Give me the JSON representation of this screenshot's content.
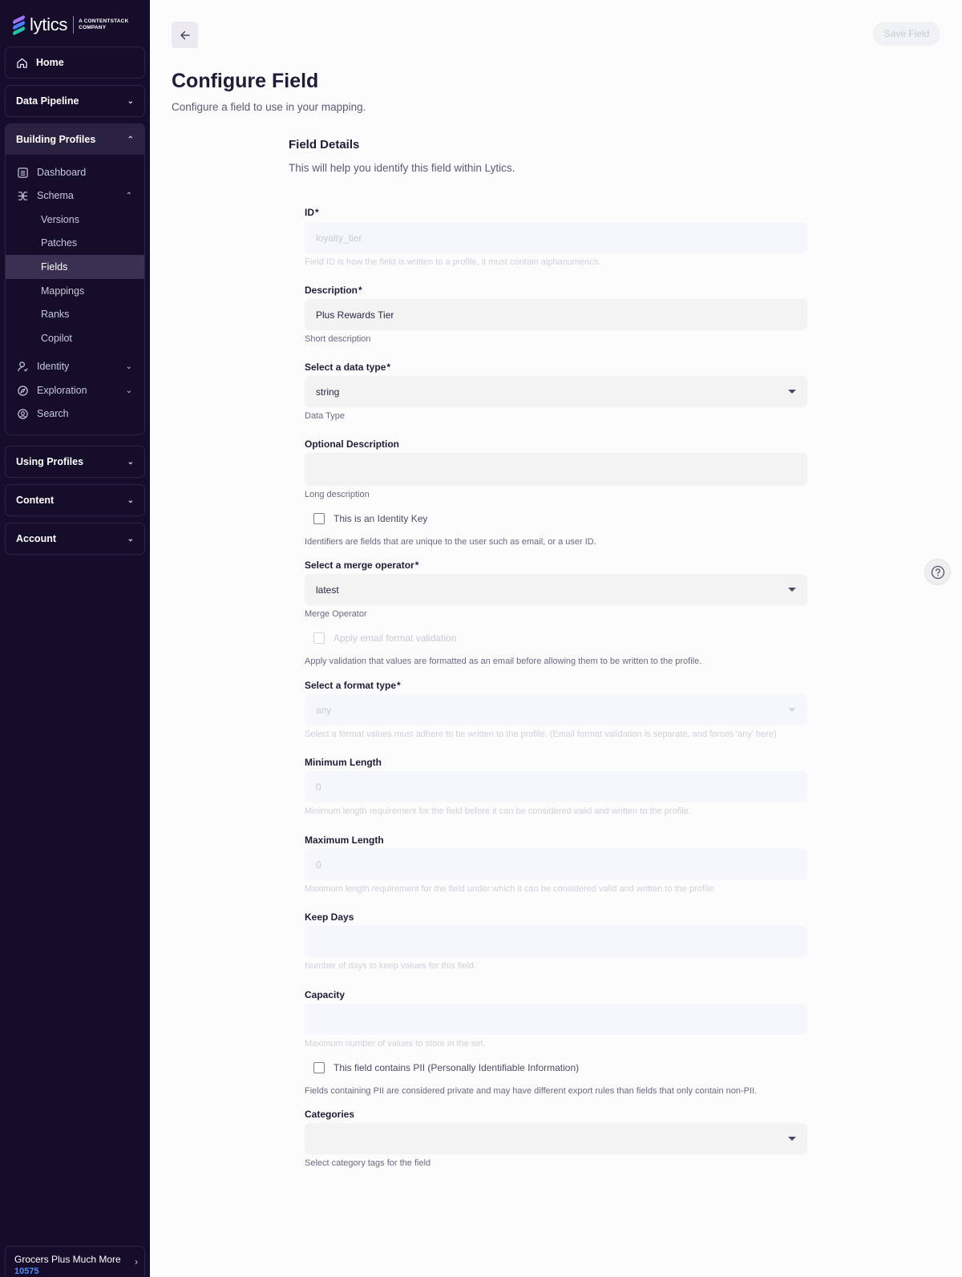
{
  "brand": {
    "name": "lytics",
    "tagline_1": "A CONTENTSTACK",
    "tagline_2": "COMPANY"
  },
  "sidebar": {
    "home": "Home",
    "data_pipeline": "Data Pipeline",
    "building_profiles": "Building Profiles",
    "dashboard": "Dashboard",
    "schema": "Schema",
    "schema_items": [
      "Versions",
      "Patches",
      "Fields",
      "Mappings",
      "Ranks",
      "Copilot"
    ],
    "identity": "Identity",
    "exploration": "Exploration",
    "search": "Search",
    "using_profiles": "Using Profiles",
    "content": "Content",
    "account": "Account"
  },
  "org": {
    "name": "Grocers Plus Much More",
    "id": "10575"
  },
  "header": {
    "save_label": "Save Field",
    "title": "Configure Field",
    "subtitle": "Configure a field to use in your mapping."
  },
  "section": {
    "title": "Field Details",
    "subtitle": "This will help you identify this field within Lytics."
  },
  "form": {
    "id": {
      "label": "ID",
      "value": "loyalty_tier",
      "help": "Field ID is how the field is written to a profile, it must contain alphanumerics."
    },
    "description": {
      "label": "Description",
      "value": "Plus Rewards Tier",
      "help": "Short description"
    },
    "data_type": {
      "label": "Select a data type",
      "value": "string",
      "help": "Data Type"
    },
    "optional_description": {
      "label": "Optional Description",
      "value": "",
      "help": "Long description"
    },
    "identity_key": {
      "label": "This is an Identity Key",
      "help": "Identifiers are fields that are unique to the user such as email, or a user ID."
    },
    "merge_operator": {
      "label": "Select a merge operator",
      "value": "latest",
      "help": "Merge Operator"
    },
    "email_validation": {
      "label": "Apply email format validation",
      "help": "Apply validation that values are formatted as an email before allowing them to be written to the profile."
    },
    "format_type": {
      "label": "Select a format type",
      "value": "any",
      "help": "Select a format values must adhere to be written to the profile. (Email format validation is separate, and forces 'any' here)"
    },
    "min_length": {
      "label": "Minimum Length",
      "value": "0",
      "help": "Minimum length requirement for the field before it can be considered valid and written to the profile."
    },
    "max_length": {
      "label": "Maximum Length",
      "value": "0",
      "help": "Maximum length requirement for the field under which it can be considered valid and written to the profile."
    },
    "keep_days": {
      "label": "Keep Days",
      "value": "",
      "help": "Number of days to keep values for this field."
    },
    "capacity": {
      "label": "Capacity",
      "value": "",
      "help": "Maximum number of values to store in the set."
    },
    "pii": {
      "label": "This field contains PII (Personally Identifiable Information)",
      "help": "Fields containing PII are considered private and may have different export rules than fields that only contain non-PII."
    },
    "categories": {
      "label": "Categories",
      "value": "",
      "help": "Select category tags for the field"
    },
    "required_mark": "*"
  },
  "icons": [
    "home-icon",
    "dashboard-icon",
    "schema-icon",
    "identity-icon",
    "exploration-icon",
    "search-icon",
    "back-arrow-icon",
    "help-icon",
    "chevron-down-icon",
    "chevron-up-icon",
    "chevron-right-icon"
  ],
  "colors": {
    "sidebar_bg": "#150d2a",
    "active_item_bg": "#3a3052",
    "org_id": "#4d8dff",
    "page_bg": "#fcfcfd"
  }
}
